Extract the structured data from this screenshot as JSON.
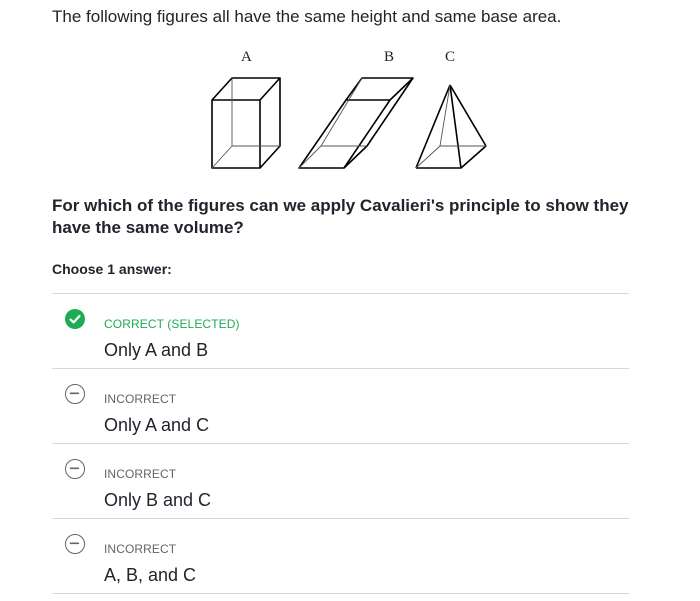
{
  "intro_text": "The following figures all have the same height and same base area.",
  "figure": {
    "labels": [
      "A",
      "B",
      "C"
    ]
  },
  "question_text": "For which of the figures can we apply Cavalieri's principle to show they have the same volume?",
  "choose_label": "Choose 1 answer:",
  "colors": {
    "correct": "#1fab54",
    "incorrect_marker": "#626569",
    "divider": "#d6d8da"
  },
  "choices": [
    {
      "status": "CORRECT (SELECTED)",
      "text": "Only A and B",
      "icon": "check-icon"
    },
    {
      "status": "INCORRECT",
      "text": "Only A and C",
      "icon": "minus-circle-icon"
    },
    {
      "status": "INCORRECT",
      "text": "Only B and C",
      "icon": "minus-circle-icon"
    },
    {
      "status": "INCORRECT",
      "text": "A, B, and C",
      "icon": "minus-circle-icon"
    }
  ]
}
